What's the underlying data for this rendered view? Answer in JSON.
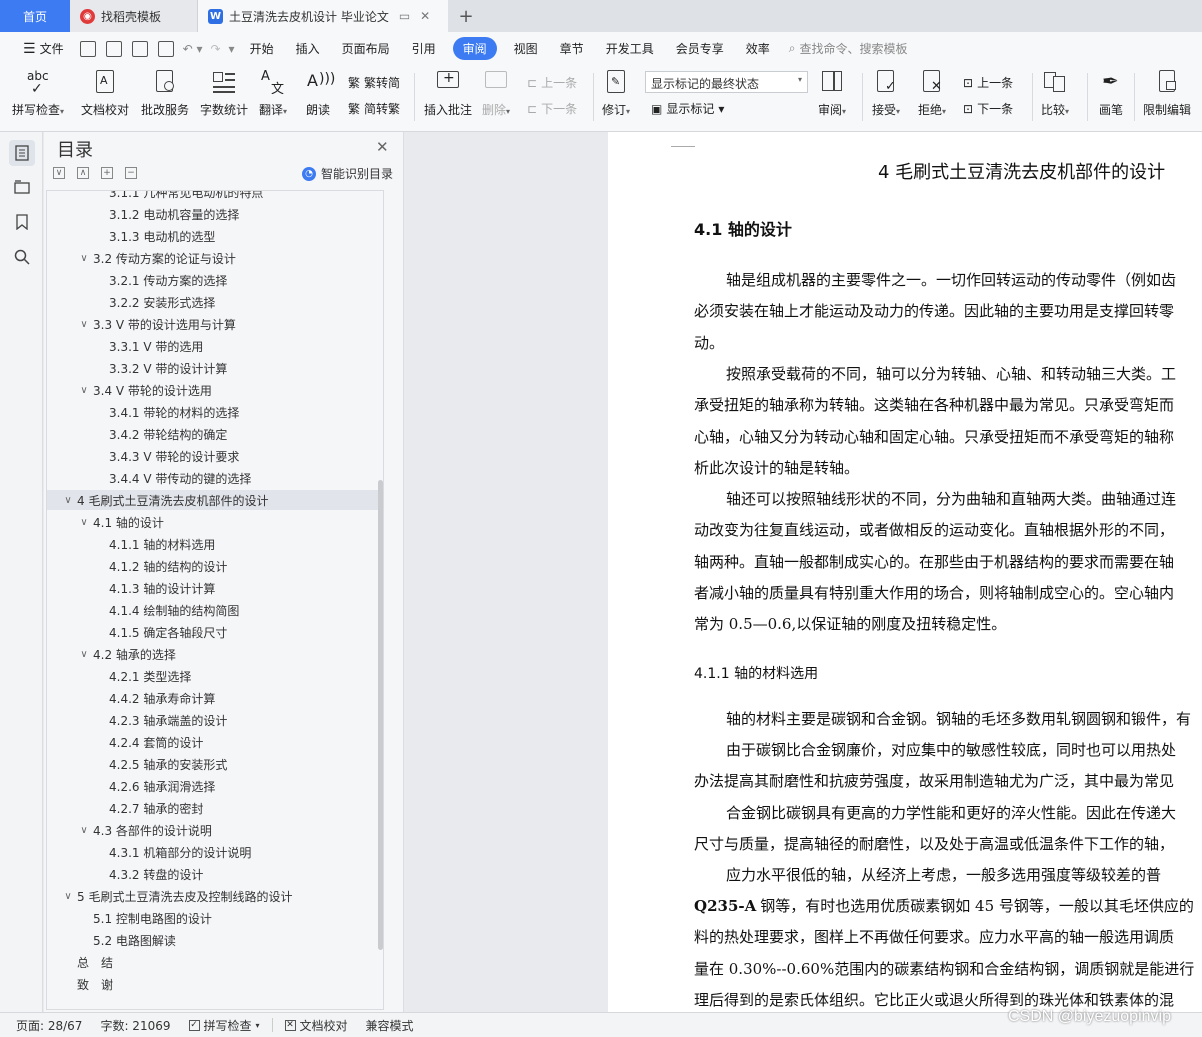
{
  "tabs": {
    "home": "首页",
    "templates": "找稻壳模板",
    "document": "土豆清洗去皮机设计 毕业论文",
    "new_tab": "+"
  },
  "menu": {
    "file": "文件",
    "items": [
      "开始",
      "插入",
      "页面布局",
      "引用",
      "审阅",
      "视图",
      "章节",
      "开发工具",
      "会员专享",
      "效率"
    ],
    "active": "审阅",
    "search": "查找命令、搜索模板"
  },
  "ribbon": {
    "spell_check": "拼写检查",
    "doc_proof": "文档校对",
    "batch_service": "批改服务",
    "word_count": "字数统计",
    "translate": "翻译",
    "read_aloud": "朗读",
    "trad_to_simp": "繁转简",
    "simp_to_trad": "简转繁",
    "insert_comment": "插入批注",
    "delete": "删除",
    "prev_comment": "上一条",
    "next_comment": "下一条",
    "track_changes": "修订",
    "markup_state": "显示标记的最终状态",
    "show_markup": "显示标记",
    "review": "审阅",
    "accept": "接受",
    "reject": "拒绝",
    "prev_change": "上一条",
    "next_change": "下一条",
    "compare": "比较",
    "pen": "画笔",
    "restrict_edit": "限制编辑"
  },
  "toc": {
    "title": "目录",
    "smart": "智能识别目录",
    "items": [
      {
        "level": 3,
        "text": "3.1.1 几种常见电动机的特点",
        "collapse": ""
      },
      {
        "level": 3,
        "text": "3.1.2 电动机容量的选择",
        "collapse": ""
      },
      {
        "level": 3,
        "text": "3.1.3 电动机的选型",
        "collapse": ""
      },
      {
        "level": 2,
        "text": "3.2 传动方案的论证与设计",
        "collapse": "∨"
      },
      {
        "level": 3,
        "text": "3.2.1 传动方案的选择",
        "collapse": ""
      },
      {
        "level": 3,
        "text": "3.2.2 安装形式选择",
        "collapse": ""
      },
      {
        "level": 2,
        "text": "3.3 V 带的设计选用与计算",
        "collapse": "∨"
      },
      {
        "level": 3,
        "text": "3.3.1 V 带的选用",
        "collapse": ""
      },
      {
        "level": 3,
        "text": "3.3.2 V 带的设计计算",
        "collapse": ""
      },
      {
        "level": 2,
        "text": "3.4 V 带轮的设计选用",
        "collapse": "∨"
      },
      {
        "level": 3,
        "text": "3.4.1 带轮的材料的选择",
        "collapse": ""
      },
      {
        "level": 3,
        "text": "3.4.2 带轮结构的确定",
        "collapse": ""
      },
      {
        "level": 3,
        "text": "3.4.3 V 带轮的设计要求",
        "collapse": ""
      },
      {
        "level": 3,
        "text": "3.4.4 V 带传动的键的选择",
        "collapse": ""
      },
      {
        "level": 1,
        "text": "4 毛刷式土豆清洗去皮机部件的设计",
        "collapse": "∨",
        "selected": true
      },
      {
        "level": 2,
        "text": "4.1 轴的设计",
        "collapse": "∨"
      },
      {
        "level": 3,
        "text": "4.1.1 轴的材料选用",
        "collapse": ""
      },
      {
        "level": 3,
        "text": "4.1.2 轴的结构的设计",
        "collapse": ""
      },
      {
        "level": 3,
        "text": "4.1.3 轴的设计计算",
        "collapse": ""
      },
      {
        "level": 3,
        "text": "4.1.4 绘制轴的结构简图",
        "collapse": ""
      },
      {
        "level": 3,
        "text": "4.1.5 确定各轴段尺寸",
        "collapse": ""
      },
      {
        "level": 2,
        "text": "4.2 轴承的选择",
        "collapse": "∨"
      },
      {
        "level": 3,
        "text": "4.2.1 类型选择",
        "collapse": ""
      },
      {
        "level": 3,
        "text": "4.4.2 轴承寿命计算",
        "collapse": ""
      },
      {
        "level": 3,
        "text": "4.2.3 轴承端盖的设计",
        "collapse": ""
      },
      {
        "level": 3,
        "text": "4.2.4 套筒的设计",
        "collapse": ""
      },
      {
        "level": 3,
        "text": "4.2.5 轴承的安装形式",
        "collapse": ""
      },
      {
        "level": 3,
        "text": "4.2.6 轴承润滑选择",
        "collapse": ""
      },
      {
        "level": 3,
        "text": "4.2.7 轴承的密封",
        "collapse": ""
      },
      {
        "level": 2,
        "text": "4.3 各部件的设计说明",
        "collapse": "∨"
      },
      {
        "level": 3,
        "text": "4.3.1 机箱部分的设计说明",
        "collapse": ""
      },
      {
        "level": 3,
        "text": "4.3.2 转盘的设计",
        "collapse": ""
      },
      {
        "level": 1,
        "text": "5 毛刷式土豆清洗去皮及控制线路的设计",
        "collapse": "∨"
      },
      {
        "level": 2,
        "text": "5.1 控制电路图的设计",
        "collapse": ""
      },
      {
        "level": 2,
        "text": "5.2 电路图解读",
        "collapse": ""
      },
      {
        "level": 1,
        "text": "总　结",
        "collapse": ""
      },
      {
        "level": 1,
        "text": "致　谢",
        "collapse": ""
      }
    ]
  },
  "document": {
    "chapter_title": "4 毛刷式土豆清洗去皮机部件的设计",
    "section_title": "4.1 轴的设计",
    "subsection_title": "4.1.1 轴的材料选用",
    "lines_a": [
      "轴是组成机器的主要零件之一。一切作回转运动的传动零件（例如齿",
      "必须安装在轴上才能运动及动力的传递。因此轴的主要功用是支撑回转零",
      "动。",
      "按照承受载荷的不同，轴可以分为转轴、心轴、和转动轴三大类。工",
      "承受扭矩的轴承称为转轴。这类轴在各种机器中最为常见。只承受弯矩而",
      "心轴，心轴又分为转动心轴和固定心轴。只承受扭矩而不承受弯矩的轴称",
      "析此次设计的轴是转轴。",
      "轴还可以按照轴线形状的不同，分为曲轴和直轴两大类。曲轴通过连",
      "动改变为往复直线运动，或者做相反的运动变化。直轴根据外形的不同，",
      "轴两种。直轴一般都制成实心的。在那些由于机器结构的要求而需要在轴",
      "者减小轴的质量具有特别重大作用的场合，则将轴制成空心的。空心轴内",
      "常为 0.5—0.6,以保证轴的刚度及扭转稳定性。"
    ],
    "lines_b": [
      "轴的材料主要是碳钢和合金钢。钢轴的毛坯多数用轧钢圆钢和锻件，有",
      "由于碳钢比合金钢廉价，对应集中的敏感性较底，同时也可以用热处",
      "办法提高其耐磨性和抗疲劳强度，故采用制造轴尤为广泛，其中最为常见",
      "合金钢比碳钢具有更高的力学性能和更好的淬火性能。因此在传递大",
      "尺寸与质量，提高轴径的耐磨性，以及处于高温或低温条件下工作的轴，",
      "应力水平很低的轴，从经济上考虑，一般多选用强度等级较差的普",
      "钢等，有时也选用优质碳素钢如 45 号钢等，一般以其毛坯供应的",
      "料的热处理要求，图样上不再做任何要求。应力水平高的轴一般选用调质",
      "量在 0.30%--0.60%范围内的碳素结构钢和合金结构钢，调质钢就是能进行",
      "理后得到的是索氏体组织。它比正火或退火所得到的珠光体和铁素体的混"
    ],
    "q235": "Q235-A"
  },
  "status": {
    "page": "页面: 28/67",
    "words": "字数: 21069",
    "spell": "拼写检查",
    "proof": "文档校对",
    "compat": "兼容模式"
  },
  "watermark": "CSDN @biyezuopinvip"
}
